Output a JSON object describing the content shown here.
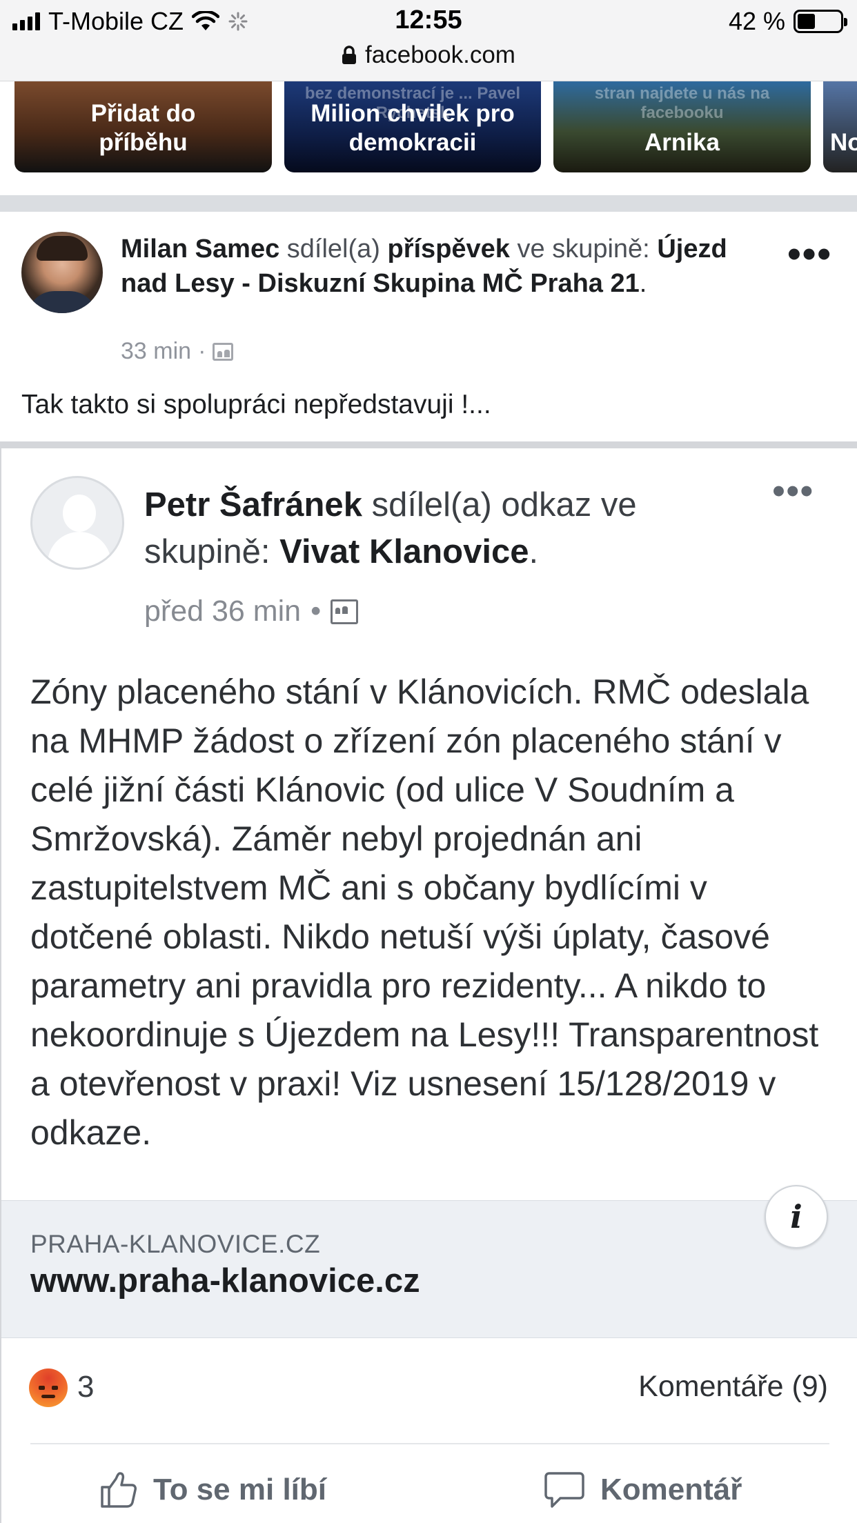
{
  "status_bar": {
    "carrier": "T-Mobile CZ",
    "time": "12:55",
    "battery": "42 %",
    "battery_level": 0.42,
    "url": "facebook.com"
  },
  "stories": [
    {
      "label_line1": "Přidat do",
      "label_line2": "příběhu"
    },
    {
      "label_line1": "Milion chvilek pro",
      "label_line2": "demokracii",
      "overlay_text": "bez demonstrací je ... Pavel Rychetsk"
    },
    {
      "label_line1": "",
      "label_line2": "Arnika",
      "overlay_text": "stran najdete u nás na facebooku"
    },
    {
      "label_line1": "",
      "label_line2": "No"
    }
  ],
  "post": {
    "author": "Milan Samec",
    "action_text": "sdílel(a)",
    "action_object": "příspěvek",
    "in_text": "ve skupině:",
    "group": "Újezd nad Lesy - Diskuzní Skupina MČ Praha 21",
    "group_suffix": ".",
    "time": "33 min",
    "meta_sep": "·",
    "body": "Tak takto si spolupráci nepředstavuji !...",
    "more_label": "•••"
  },
  "shared": {
    "author": "Petr Šafránek",
    "action_text": "sdílel(a) odkaz ve",
    "in_text": "skupině:",
    "group": "Vivat Klanovice",
    "group_suffix": ".",
    "time": "před 36 min",
    "meta_sep": "•",
    "more_label": "•••",
    "text": "Zóny placeného stání v Klánovicích. RMČ odeslala na MHMP žádost o zřízení zón placeného stání v celé jižní části Klánovic (od ulice V Soudním a Smržovská). Záměr nebyl projednán ani zastupitelstvem MČ ani s občany bydlícími v dotčené oblasti.  Nikdo netuší výši úplaty, časové parametry ani pravidla pro rezidenty... A nikdo to nekoordinuje s Újezdem na Lesy!!! Transparentnost a otevřenost v praxi! Viz usnesení 15/128/2019 v odkaze.",
    "link_domain": "PRAHA-KLANOVICE.CZ",
    "link_title": "www.praha-klanovice.cz",
    "info_label": "i",
    "reaction_count": "3",
    "comments": "Komentáře (9)",
    "like_label": "To se mi líbí",
    "comment_label": "Komentář"
  }
}
